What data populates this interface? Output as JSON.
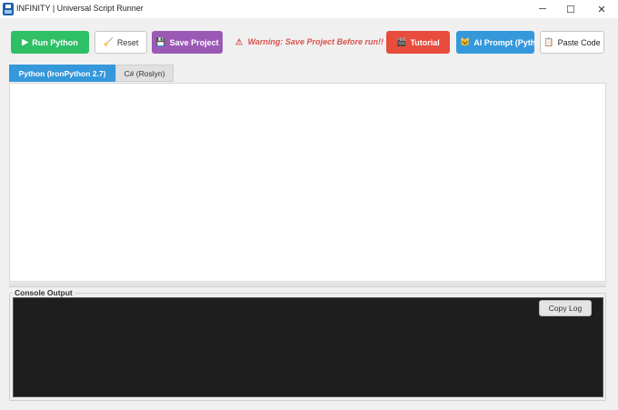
{
  "window": {
    "title": "INFINITY | Universal Script Runner",
    "icon": "app-logo-icon",
    "controls": {
      "minimize": "─",
      "maximize": "☐",
      "close": "✕"
    }
  },
  "toolbar": {
    "run_label": "Run Python",
    "run_icon": "▶",
    "reset_label": "Reset",
    "reset_icon": "🧹",
    "save_label": "Save Project",
    "save_icon": "💾",
    "warning_text": "Warning: Save Project Before run!!",
    "warning_icon": "⚠",
    "tutorial_label": "Tutorial",
    "tutorial_icon": "🎬",
    "ai_label": "AI Prompt (Python)",
    "ai_icon": "🐱",
    "paste_label": "Paste Code",
    "paste_icon": "📋"
  },
  "tabs": [
    {
      "label": "Python (IronPython 2.7)",
      "active": true
    },
    {
      "label": "C# (Roslyn)",
      "active": false
    }
  ],
  "editor": {
    "content": ""
  },
  "console": {
    "label": "Console Output",
    "content": "",
    "copy_label": "Copy Log"
  },
  "colors": {
    "run": "#2fbf66",
    "save": "#9b59b6",
    "warning": "#d9534f",
    "tutorial": "#e74c3c",
    "ai": "#3498db",
    "active_tab": "#3498db",
    "console_bg": "#1e1e1e"
  }
}
